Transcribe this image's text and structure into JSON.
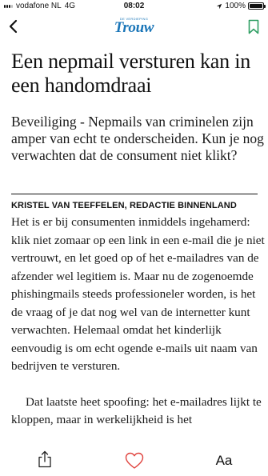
{
  "status_bar": {
    "carrier": "vodafone NL",
    "network": "4G",
    "time": "08:02",
    "battery": "100%",
    "battery_level": 1.0
  },
  "nav": {
    "logo_tag": "DE VERDIEPING",
    "logo": "Trouw"
  },
  "article": {
    "headline": "Een nepmail versturen kan in een handomdraai",
    "lead": "Beveiliging - Nepmails van criminelen zijn amper van echt te onderscheiden. Kun je nog verwachten dat de consument niet klikt?",
    "byline": "KRISTEL VAN TEEFFELEN, REDACTIE BINNENLAND",
    "paragraphs": [
      "Het is er bij consumenten inmiddels ingehamerd: klik niet zomaar op een link in een e-mail die je niet vertrouwt, en let goed op of het e-mailadres van de afzender wel legitiem is. Maar nu de zogenoemde phishingmails steeds professioneler worden, is het de vraag of je dat nog wel van de internetter kunt verwachten. Helemaal omdat het kinderlijk eenvoudig is om echt ogende e-mails uit naam van bedrijven te versturen.",
      "Dat laatste heet spoofing: het e-mailadres lijkt te kloppen, maar in werkelijkheid is het"
    ]
  },
  "toolbar": {
    "font_label": "Aa"
  },
  "colors": {
    "brand": "#1b76b8",
    "bookmark": "#2e9e63",
    "heart": "#e0443f"
  },
  "icons": [
    "back-icon",
    "bookmark-icon",
    "share-icon",
    "heart-icon",
    "location-icon",
    "wifi-icon"
  ]
}
